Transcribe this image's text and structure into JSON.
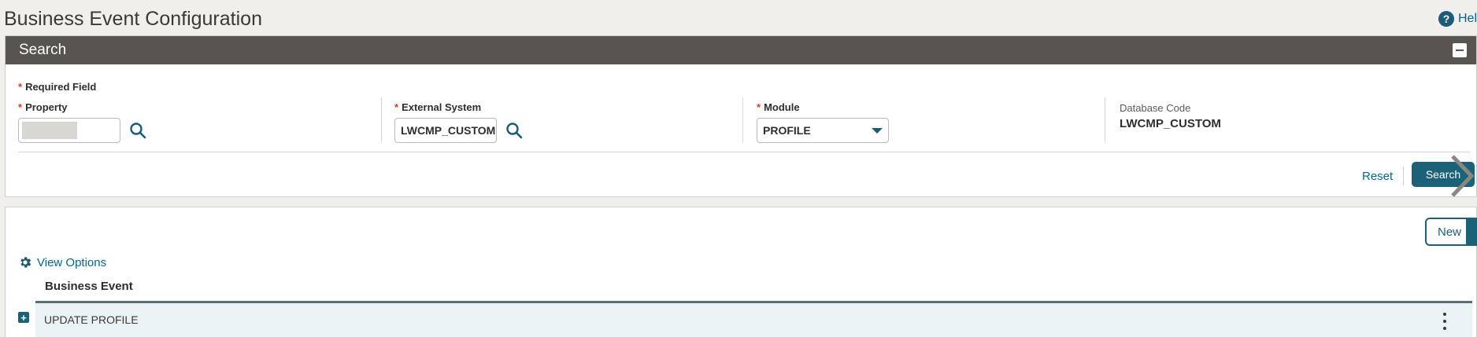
{
  "page": {
    "title": "Business Event Configuration",
    "help_label": "Help"
  },
  "search_panel": {
    "title": "Search",
    "required_field_label": "Required Field",
    "fields": {
      "property": {
        "label": "Property",
        "value": ""
      },
      "external_system": {
        "label": "External System",
        "value": "LWCMP_CUSTOM"
      },
      "module": {
        "label": "Module",
        "value": "PROFILE"
      },
      "database_code": {
        "label": "Database Code",
        "value": "LWCMP_CUSTOM"
      }
    },
    "reset_label": "Reset",
    "search_label": "Search"
  },
  "results": {
    "new_label": "New",
    "view_options_label": "View Options",
    "columns": [
      "Business Event"
    ],
    "rows": [
      {
        "business_event": "UPDATE PROFILE"
      }
    ]
  },
  "colors": {
    "header_bg": "#585551",
    "accent": "#1b6177",
    "link": "#00688c",
    "required": "#d63b25"
  }
}
